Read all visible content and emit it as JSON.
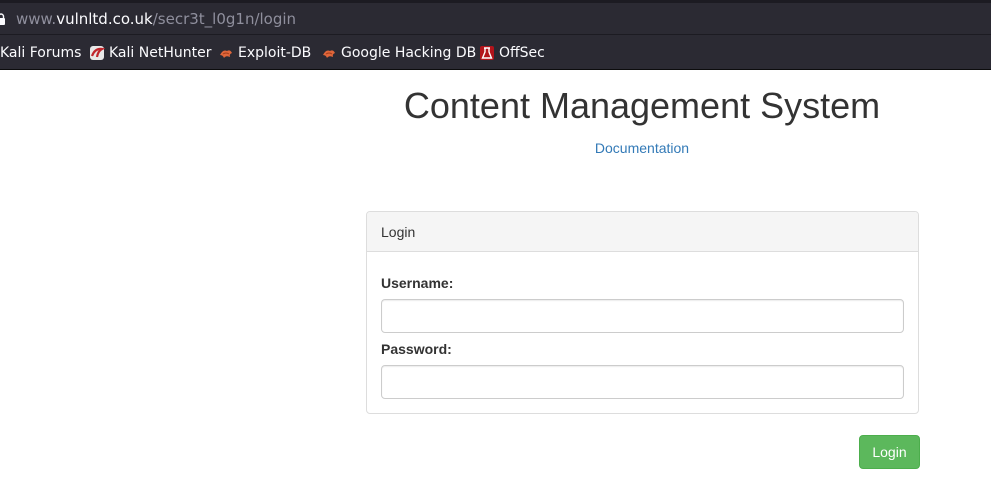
{
  "browser": {
    "url": {
      "prefix": "www.",
      "host": "vulnltd.co.uk",
      "path": "/secr3t_l0g1n/login"
    },
    "bookmarks": [
      {
        "label": "Kali Forums",
        "icon": "none"
      },
      {
        "label": "Kali NetHunter",
        "icon": "kali-nethunter-icon"
      },
      {
        "label": "Exploit-DB",
        "icon": "exploit-db-icon"
      },
      {
        "label": "Google Hacking DB",
        "icon": "exploit-db-icon"
      },
      {
        "label": "OffSec",
        "icon": "offsec-icon"
      }
    ]
  },
  "page": {
    "title": "Content Management System",
    "documentation_link": "Documentation",
    "panel": {
      "heading": "Login",
      "username_label": "Username:",
      "username_value": "",
      "password_label": "Password:",
      "password_value": ""
    },
    "submit_label": "Login"
  },
  "colors": {
    "link": "#337ab7",
    "button_success": "#5cb85c",
    "chrome_dark": "#2b2a33"
  }
}
